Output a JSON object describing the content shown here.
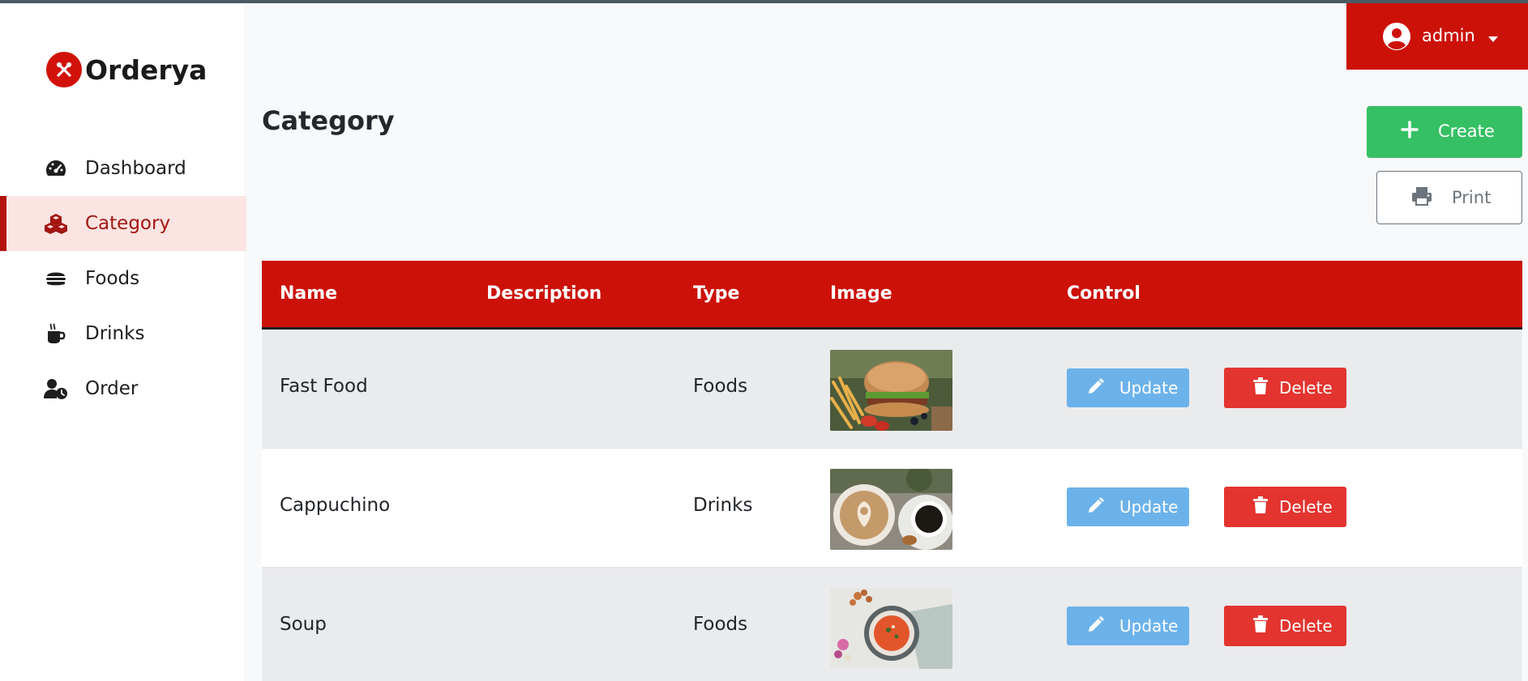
{
  "app": {
    "brand": "Orderya",
    "accent": "#cc1109"
  },
  "sidebar": {
    "items": [
      {
        "label": "Dashboard",
        "icon": "speedometer-icon",
        "active": false
      },
      {
        "label": "Category",
        "icon": "cubes-icon",
        "active": true
      },
      {
        "label": "Foods",
        "icon": "burger-icon",
        "active": false
      },
      {
        "label": "Drinks",
        "icon": "coffee-mug-icon",
        "active": false
      },
      {
        "label": "Order",
        "icon": "user-clock-icon",
        "active": false
      }
    ]
  },
  "header": {
    "user": "admin",
    "user_icon": "user-circle-icon",
    "dropdown_icon": "caret-down-icon"
  },
  "page": {
    "title": "Category",
    "create_label": "Create",
    "print_label": "Print"
  },
  "table": {
    "columns": [
      "Name",
      "Description",
      "Type",
      "Image",
      "Control"
    ],
    "rows": [
      {
        "name": "Fast Food",
        "description": "",
        "type": "Foods",
        "image": "burger-fries-photo",
        "update_label": "Update",
        "delete_label": "Delete"
      },
      {
        "name": "Cappuchino",
        "description": "",
        "type": "Drinks",
        "image": "cappuccino-cups-photo",
        "update_label": "Update",
        "delete_label": "Delete"
      },
      {
        "name": "Soup",
        "description": "",
        "type": "Foods",
        "image": "tomato-soup-bowl-photo",
        "update_label": "Update",
        "delete_label": "Delete"
      }
    ]
  },
  "colors": {
    "create": "#35c064",
    "update": "#6cb2ea",
    "delete": "#e3342f",
    "active_nav_bg": "#fbe4e2"
  }
}
